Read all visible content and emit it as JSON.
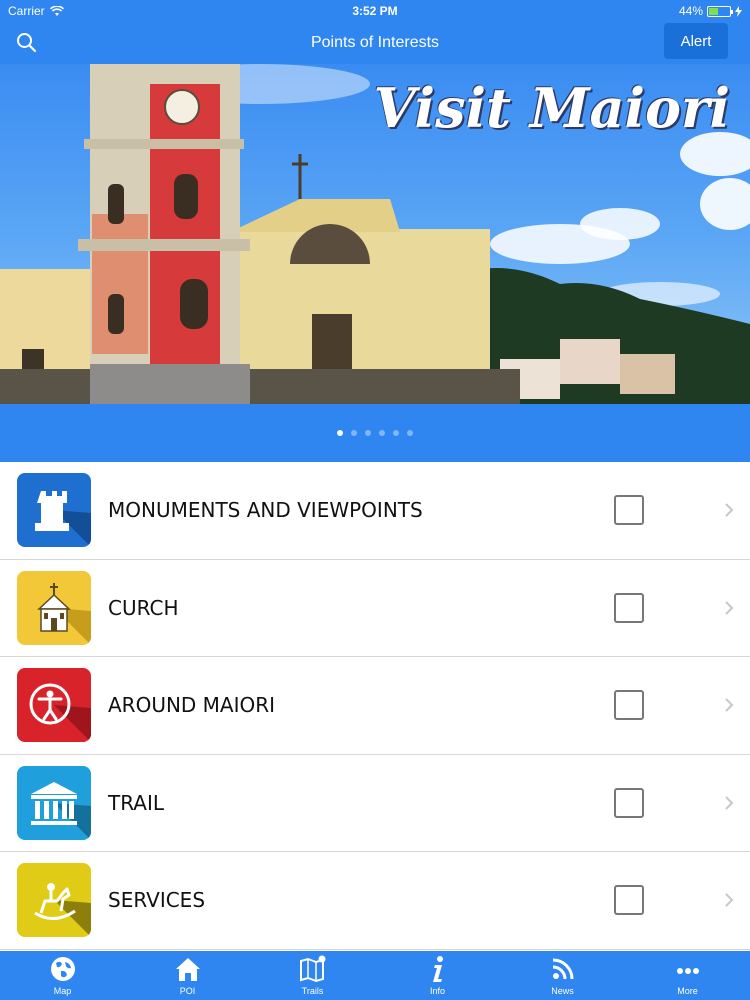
{
  "status_bar": {
    "carrier": "Carrier",
    "time": "3:52 PM",
    "battery": "44%"
  },
  "nav": {
    "title": "Points of Interests",
    "alert_label": "Alert"
  },
  "banner": {
    "title": "Visit Maiori",
    "page_count": 6,
    "active_page": 0
  },
  "categories": [
    {
      "label": "MONUMENTS AND VIEWPOINTS",
      "icon": "castle-tower-icon",
      "color": "#1e6fd0"
    },
    {
      "label": "CURCH",
      "icon": "church-icon",
      "color": "#f2c838"
    },
    {
      "label": "AROUND MAIORI",
      "icon": "person-circle-icon",
      "color": "#d8232a"
    },
    {
      "label": "TRAIL",
      "icon": "museum-icon",
      "color": "#1f9fdc"
    },
    {
      "label": "SERVICES",
      "icon": "rocking-horse-icon",
      "color": "#e0cc16"
    }
  ],
  "tabs": [
    {
      "label": "Map",
      "icon": "globe-icon"
    },
    {
      "label": "POI",
      "icon": "home-icon"
    },
    {
      "label": "Trails",
      "icon": "map-icon"
    },
    {
      "label": "Info",
      "icon": "info-icon"
    },
    {
      "label": "News",
      "icon": "rss-icon"
    },
    {
      "label": "More",
      "icon": "more-icon"
    }
  ],
  "colors": {
    "primary": "#2f86f0",
    "alert_button": "#1a6fd8"
  }
}
